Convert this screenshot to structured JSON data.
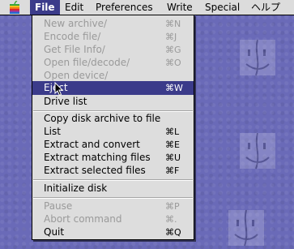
{
  "menubar": {
    "items": [
      {
        "label": "File",
        "active": true
      },
      {
        "label": "Edit"
      },
      {
        "label": "Preferences"
      },
      {
        "label": "Write"
      },
      {
        "label": "Special"
      },
      {
        "label": "ヘルプ"
      }
    ]
  },
  "menu": {
    "items": [
      {
        "label": "New archive/",
        "shortcut": "⌘N",
        "enabled": false
      },
      {
        "label": "Encode file/",
        "shortcut": "⌘J",
        "enabled": false
      },
      {
        "label": "Get File Info/",
        "shortcut": "⌘G",
        "enabled": false
      },
      {
        "label": "Open file/decode/",
        "shortcut": "⌘O",
        "enabled": false
      },
      {
        "label": "Open device/",
        "shortcut": "",
        "enabled": false
      },
      {
        "label": "Eject",
        "shortcut": "⌘W",
        "enabled": true,
        "highlighted": true
      },
      {
        "label": "Drive list",
        "shortcut": "",
        "enabled": true
      },
      {
        "label": "Copy disk archive to file",
        "shortcut": "",
        "enabled": true
      },
      {
        "label": "List",
        "shortcut": "⌘L",
        "enabled": true
      },
      {
        "label": "Extract and convert",
        "shortcut": "⌘E",
        "enabled": true
      },
      {
        "label": "Extract matching files",
        "shortcut": "⌘U",
        "enabled": true
      },
      {
        "label": "Extract selected files",
        "shortcut": "⌘F",
        "enabled": true
      },
      {
        "label": "Initialize disk",
        "shortcut": "",
        "enabled": true
      },
      {
        "label": "Pause",
        "shortcut": "⌘P",
        "enabled": false
      },
      {
        "label": "Abort command",
        "shortcut": "⌘.",
        "enabled": false
      },
      {
        "label": "Quit",
        "shortcut": "⌘Q",
        "enabled": true
      }
    ]
  },
  "icons": {
    "apple": "apple-logo-icon",
    "desktop_watermark": "finder-face-icon",
    "pointer": "arrow-cursor-icon"
  },
  "colors": {
    "desktop": "#6a6ab8",
    "menu_background": "#dddddd",
    "highlight": "#3b3b8a",
    "disabled_text": "#9a9a9a"
  }
}
